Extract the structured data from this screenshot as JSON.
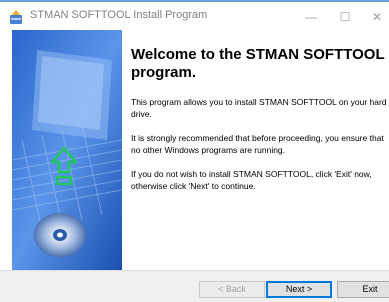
{
  "window": {
    "title": "STMAN SOFTTOOL Install Program",
    "controls": {
      "minimize": "—",
      "maximize": "☐",
      "close": "✕"
    }
  },
  "content": {
    "heading": "Welcome to the STMAN SOFTTOOL Install program.",
    "heading_line1": "Welcome to the STMAN SOFTTOOL Install",
    "heading_line2": "program.",
    "paragraphs": [
      [
        "This program allows you to install STMAN SOFTTOOL on your hard",
        "drive."
      ],
      [
        "It is strongly recommended that before proceeding, you ensure that",
        "no other Windows programs are running."
      ],
      [
        "If you do not wish to install STMAN SOFTTOOL, click 'Exit' now,",
        "otherwise click 'Next' to continue."
      ]
    ]
  },
  "buttons": {
    "back": "< Back",
    "next": "Next >",
    "exit": "Exit"
  },
  "colors": {
    "sidebar_dark": "#1e5fc6",
    "sidebar_light": "#6fa8f0",
    "arrow": "#22c55e",
    "accent": "#0078d7"
  },
  "icons": {
    "app": "installer-app-icon",
    "arrow": "upload-arrow-icon",
    "disc": "cd-disc-icon"
  }
}
